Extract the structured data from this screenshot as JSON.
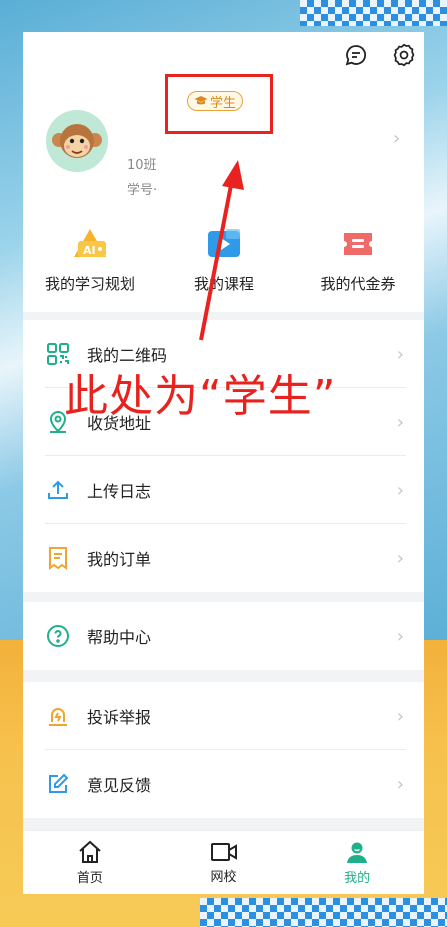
{
  "colors": {
    "accent_green": "#1fb08a",
    "badge_orange": "#d98a1e",
    "annotation_red": "#e8231f"
  },
  "header": {
    "badge_label": "学生",
    "class_text": "10班",
    "student_id_text": "学号·",
    "icons": [
      "message-icon",
      "settings-icon"
    ]
  },
  "quick_actions": [
    {
      "label": "我的学习规划",
      "icon": "ai-study-plan-icon"
    },
    {
      "label": "我的课程",
      "icon": "course-video-icon"
    },
    {
      "label": "我的代金券",
      "icon": "voucher-ticket-icon"
    }
  ],
  "menu_groups": [
    [
      {
        "label": "我的二维码",
        "icon": "qr-code-icon"
      },
      {
        "label": "收货地址",
        "icon": "location-pin-icon"
      },
      {
        "label": "上传日志",
        "icon": "upload-icon"
      },
      {
        "label": "我的订单",
        "icon": "order-receipt-icon"
      }
    ],
    [
      {
        "label": "帮助中心",
        "icon": "help-icon"
      }
    ],
    [
      {
        "label": "投诉举报",
        "icon": "complaint-icon"
      },
      {
        "label": "意见反馈",
        "icon": "feedback-edit-icon"
      }
    ]
  ],
  "tabbar": [
    {
      "label": "首页",
      "icon": "home-icon"
    },
    {
      "label": "网校",
      "icon": "video-camera-icon"
    },
    {
      "label": "我的",
      "icon": "profile-icon",
      "active": true
    }
  ],
  "annotation": {
    "text": "此处为“学生”"
  }
}
